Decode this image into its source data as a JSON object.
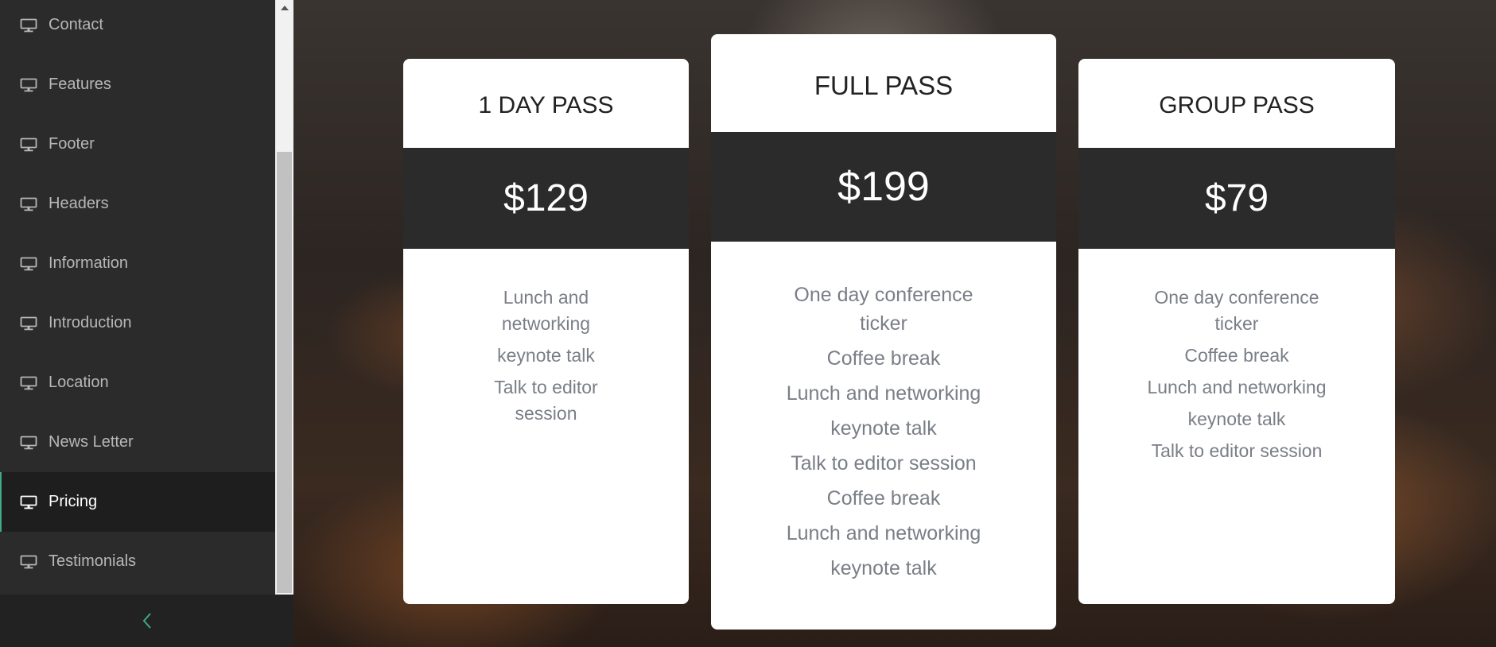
{
  "sidebar": {
    "items": [
      {
        "label": "Contact",
        "icon": "monitor-icon",
        "active": false
      },
      {
        "label": "Features",
        "icon": "monitor-icon",
        "active": false
      },
      {
        "label": "Footer",
        "icon": "monitor-icon",
        "active": false
      },
      {
        "label": "Headers",
        "icon": "monitor-icon",
        "active": false
      },
      {
        "label": "Information",
        "icon": "monitor-icon",
        "active": false
      },
      {
        "label": "Introduction",
        "icon": "monitor-icon",
        "active": false
      },
      {
        "label": "Location",
        "icon": "monitor-icon",
        "active": false
      },
      {
        "label": "News Letter",
        "icon": "monitor-icon",
        "active": false
      },
      {
        "label": "Pricing",
        "icon": "monitor-icon",
        "active": true
      },
      {
        "label": "Testimonials",
        "icon": "monitor-icon",
        "active": false
      }
    ],
    "collapse_icon": "chevron-left-icon"
  },
  "colors": {
    "accent": "#3fa98a",
    "sidebar_bg": "#2b2b2b",
    "price_band": "#2b2b2b",
    "feature_text": "#7a7e86"
  },
  "pricing": {
    "cards": [
      {
        "title": "1 DAY PASS",
        "price": "$129",
        "features": [
          "Lunch and networking",
          "keynote talk",
          "Talk to editor session"
        ]
      },
      {
        "title": "FULL PASS",
        "price": "$199",
        "features": [
          "One day conference ticker",
          "Coffee break",
          "Lunch and networking",
          "keynote talk",
          "Talk to editor session",
          "Coffee break",
          "Lunch and networking",
          "keynote talk"
        ]
      },
      {
        "title": "GROUP PASS",
        "price": "$79",
        "features": [
          "One day conference ticker",
          "Coffee break",
          "Lunch and networking",
          "keynote talk",
          "Talk to editor session"
        ]
      }
    ]
  }
}
